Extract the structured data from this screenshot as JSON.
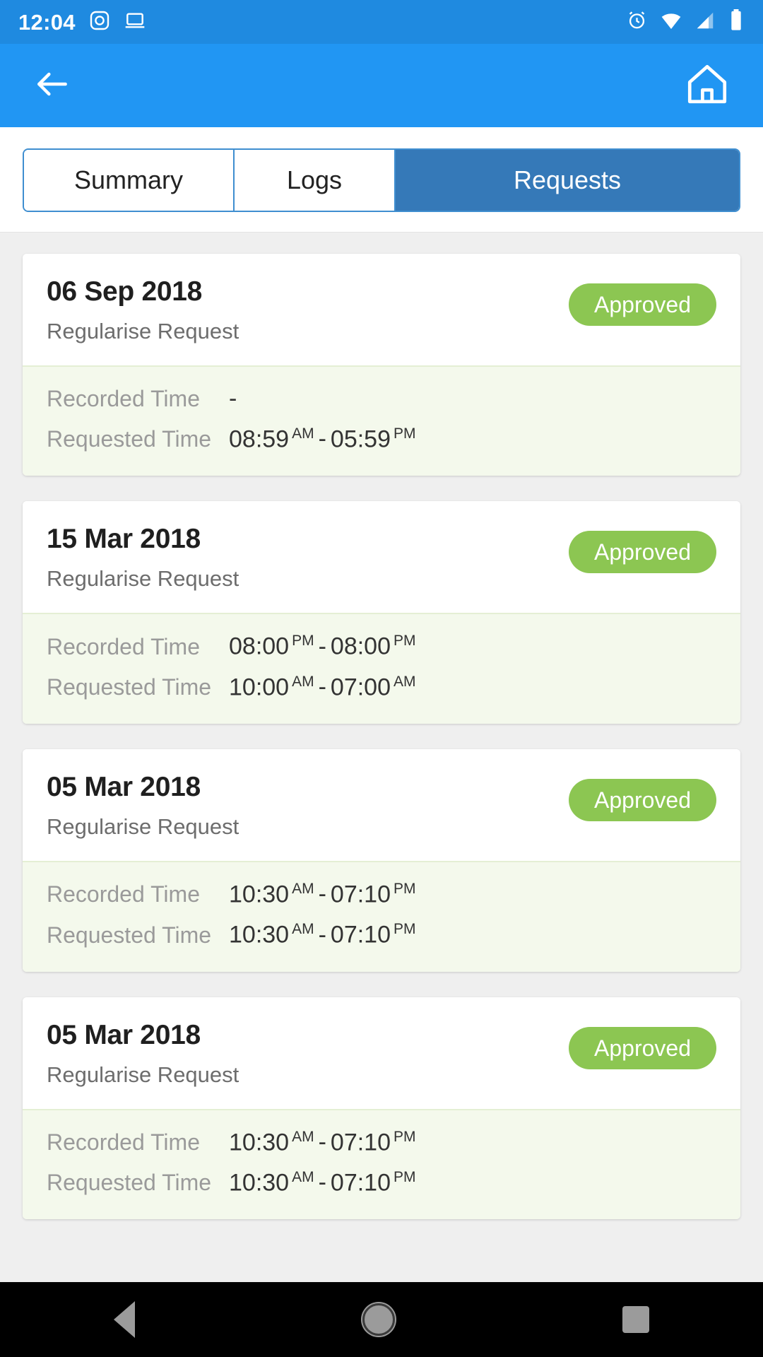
{
  "status_bar": {
    "time": "12:04",
    "left_icons": [
      "camera-icon",
      "desktop-icon"
    ],
    "right_icons": [
      "alarm-icon",
      "wifi-icon",
      "signal-icon",
      "battery-icon"
    ],
    "background_color": "#1f8ae0"
  },
  "app_bar": {
    "back_icon": "back-arrow-icon",
    "home_icon": "home-icon",
    "background_color": "#2196f3"
  },
  "tabs": {
    "items": [
      {
        "label": "Summary",
        "active": false
      },
      {
        "label": "Logs",
        "active": false
      },
      {
        "label": "Requests",
        "active": true
      }
    ],
    "accent_color": "#3579b8"
  },
  "labels": {
    "recorded_time": "Recorded Time",
    "requested_time": "Requested Time",
    "dash": "-"
  },
  "requests": [
    {
      "date": "06 Sep 2018",
      "type": "Regularise Request",
      "status": "Approved",
      "status_color": "#8cc652",
      "recorded": {
        "empty": true,
        "text": "-"
      },
      "requested": {
        "start": "08:59",
        "start_meridiem": "AM",
        "end": "05:59",
        "end_meridiem": "PM"
      }
    },
    {
      "date": "15 Mar 2018",
      "type": "Regularise Request",
      "status": "Approved",
      "status_color": "#8cc652",
      "recorded": {
        "start": "08:00",
        "start_meridiem": "PM",
        "end": "08:00",
        "end_meridiem": "PM"
      },
      "requested": {
        "start": "10:00",
        "start_meridiem": "AM",
        "end": "07:00",
        "end_meridiem": "AM"
      }
    },
    {
      "date": "05 Mar 2018",
      "type": "Regularise Request",
      "status": "Approved",
      "status_color": "#8cc652",
      "recorded": {
        "start": "10:30",
        "start_meridiem": "AM",
        "end": "07:10",
        "end_meridiem": "PM"
      },
      "requested": {
        "start": "10:30",
        "start_meridiem": "AM",
        "end": "07:10",
        "end_meridiem": "PM"
      }
    },
    {
      "date": "05 Mar 2018",
      "type": "Regularise Request",
      "status": "Approved",
      "status_color": "#8cc652",
      "recorded": {
        "start": "10:30",
        "start_meridiem": "AM",
        "end": "07:10",
        "end_meridiem": "PM"
      },
      "requested": {
        "start": "10:30",
        "start_meridiem": "AM",
        "end": "07:10",
        "end_meridiem": "PM"
      }
    }
  ],
  "nav_bar": {
    "back": "back-triangle-icon",
    "home": "home-circle-icon",
    "recents": "recents-square-icon"
  }
}
